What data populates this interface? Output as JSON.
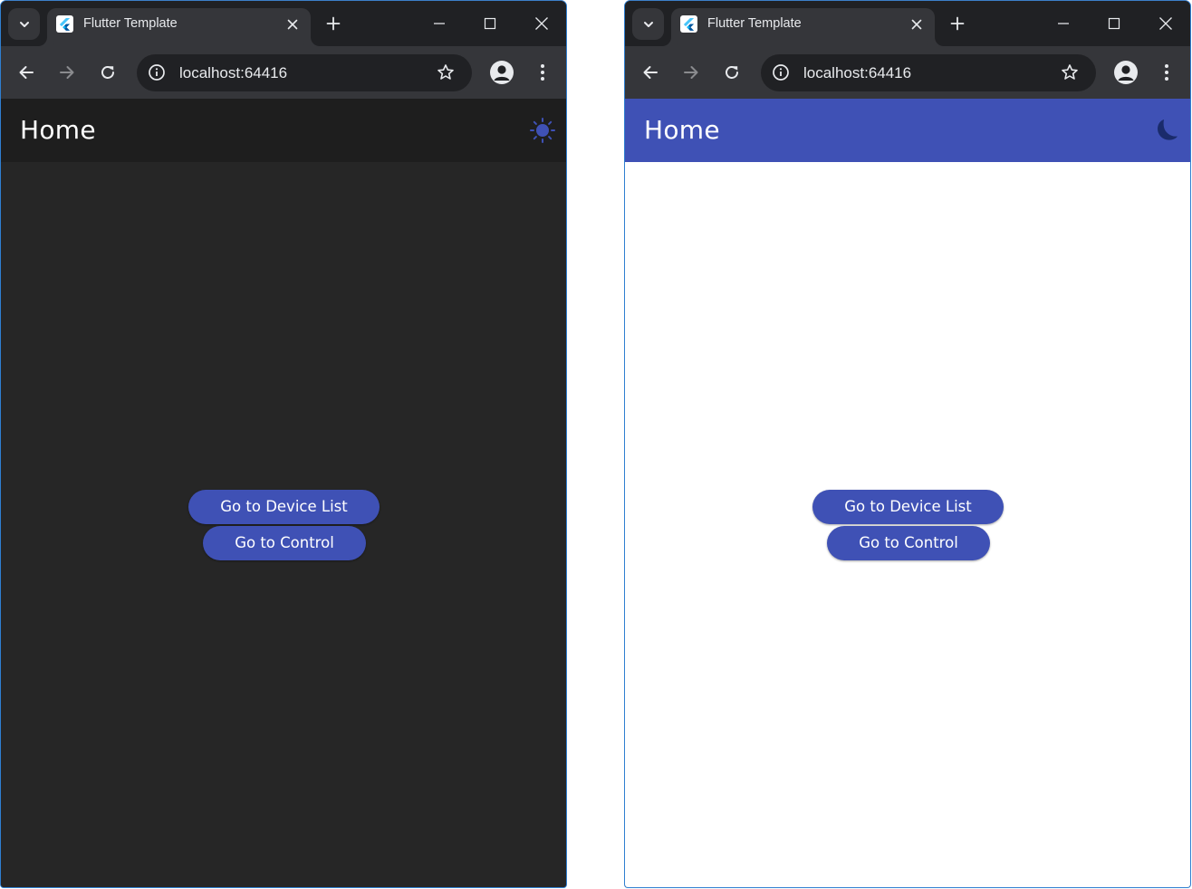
{
  "colors": {
    "accent": "#3f51b5",
    "dark_background": "#262626",
    "dark_appbar": "#1e1e1e",
    "light_background": "#ffffff",
    "browser_frame": "#35363a"
  },
  "windows": [
    {
      "theme": "dark",
      "tab": {
        "title": "Flutter Template",
        "favicon": "flutter-logo-icon"
      },
      "address_bar": {
        "url": "localhost:64416"
      },
      "appbar": {
        "title": "Home",
        "theme_toggle_icon": "sun-icon"
      },
      "buttons": {
        "device_list": "Go to Device List",
        "control": "Go to Control"
      }
    },
    {
      "theme": "light",
      "tab": {
        "title": "Flutter Template",
        "favicon": "flutter-logo-icon"
      },
      "address_bar": {
        "url": "localhost:64416"
      },
      "appbar": {
        "title": "Home",
        "theme_toggle_icon": "moon-icon"
      },
      "buttons": {
        "device_list": "Go to Device List",
        "control": "Go to Control"
      }
    }
  ]
}
